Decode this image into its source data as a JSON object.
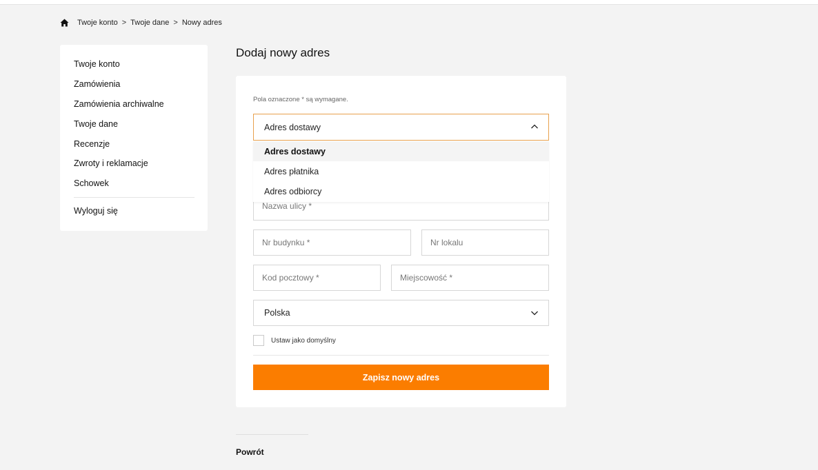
{
  "breadcrumb": {
    "home_icon": "home-icon",
    "items": [
      "Twoje konto",
      "Twoje dane",
      "Nowy adres"
    ],
    "separator": ">"
  },
  "sidebar": {
    "items": [
      {
        "label": "Twoje konto"
      },
      {
        "label": "Zamówienia"
      },
      {
        "label": "Zamówienia archiwalne"
      },
      {
        "label": "Twoje dane"
      },
      {
        "label": "Recenzje"
      },
      {
        "label": "Zwroty i reklamacje"
      },
      {
        "label": "Schowek"
      }
    ],
    "logout": "Wyloguj się"
  },
  "page": {
    "title": "Dodaj nowy adres"
  },
  "form": {
    "required_note": "Pola oznaczone * są wymagane.",
    "address_type": {
      "selected": "Adres dostawy",
      "options": [
        "Adres dostawy",
        "Adres płatnika",
        "Adres odbiorcy"
      ],
      "open": true
    },
    "street_placeholder": "Nazwa ulicy *",
    "building_placeholder": "Nr budynku *",
    "apartment_placeholder": "Nr lokalu",
    "postal_placeholder": "Kod pocztowy *",
    "city_placeholder": "Miejscowość *",
    "country": "Polska",
    "default_checkbox_label": "Ustaw jako domyślny",
    "default_checked": false,
    "submit_label": "Zapisz nowy adres"
  },
  "back_label": "Powrót",
  "colors": {
    "accent": "#fb7d00",
    "focus_border": "#e8a04c",
    "background": "#f3f3f3"
  }
}
